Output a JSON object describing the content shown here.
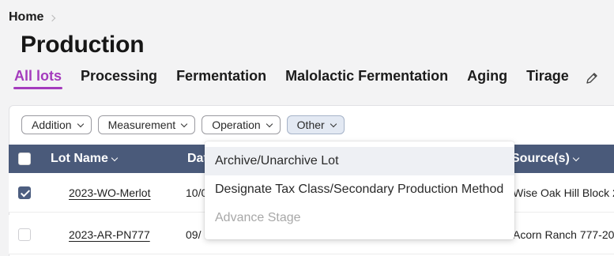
{
  "breadcrumb": {
    "home": "Home"
  },
  "page": {
    "title": "Production"
  },
  "tabs": [
    {
      "label": "All lots",
      "active": true
    },
    {
      "label": "Processing"
    },
    {
      "label": "Fermentation"
    },
    {
      "label": "Malolactic Fermentation"
    },
    {
      "label": "Aging"
    },
    {
      "label": "Tirage"
    }
  ],
  "filters": [
    {
      "label": "Addition"
    },
    {
      "label": "Measurement"
    },
    {
      "label": "Operation"
    },
    {
      "label": "Other",
      "selected": true
    }
  ],
  "table": {
    "columns": {
      "lot_name": "Lot Name",
      "date": "Dat",
      "source": "Source(s)"
    },
    "rows": [
      {
        "checked": true,
        "lot_name": "2023-WO-Merlot",
        "date": "10/0",
        "source": "Wise Oak Hill Block 2"
      },
      {
        "checked": false,
        "lot_name": "2023-AR-PN777",
        "date": "09/",
        "source": "Acorn Ranch 777-202"
      }
    ]
  },
  "menu": {
    "items": [
      {
        "label": "Archive/Unarchive Lot",
        "state": "hover"
      },
      {
        "label": "Designate Tax Class/Secondary Production Method",
        "state": "normal"
      },
      {
        "label": "Advance Stage",
        "state": "disabled"
      }
    ]
  },
  "colors": {
    "accent": "#a43bbd",
    "header": "#4a5a7a",
    "selected_filter": "#e3e9f3"
  },
  "icons": {
    "edit": "pencil-icon",
    "dropdown": "chevron-down-icon",
    "breadcrumb_sep": "chevron-right-icon"
  }
}
